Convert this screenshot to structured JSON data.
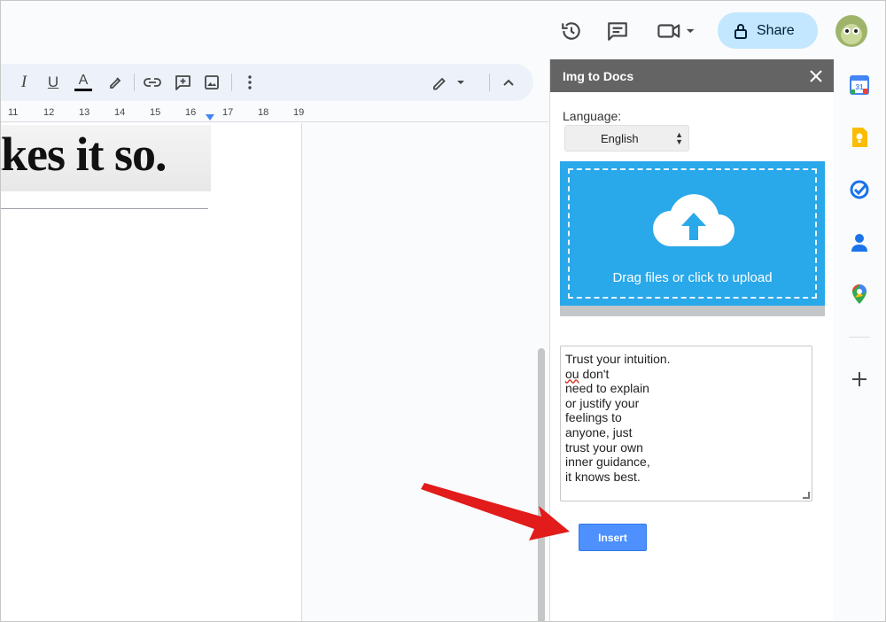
{
  "header": {
    "share_label": "Share",
    "icons": [
      "history-icon",
      "comment-icon",
      "video-call-icon",
      "lock-icon",
      "avatar"
    ]
  },
  "toolbar": {
    "icons": [
      "italic-icon",
      "underline-icon",
      "text-color-icon",
      "highlight-icon",
      "link-icon",
      "add-comment-icon",
      "insert-image-icon",
      "more-options-icon",
      "editing-mode-icon",
      "collapse-icon"
    ],
    "italic": "I",
    "underline": "U",
    "text_color": "A"
  },
  "ruler": {
    "numbers": [
      "11",
      "12",
      "13",
      "14",
      "15",
      "16",
      "17",
      "18",
      "19"
    ]
  },
  "document": {
    "image_text": "akes it so."
  },
  "addon": {
    "title": "Img to Docs",
    "language_label": "Language:",
    "language_value": "English",
    "upload_text": "Drag files or click to upload",
    "ocr_lines": [
      "Trust your intuition.",
      "ou don't",
      "need to explain",
      "or justify your",
      "feelings to",
      "anyone, just",
      "trust your own",
      "inner guidance,",
      "it knows best."
    ],
    "insert_label": "Insert"
  },
  "side_rail": {
    "icons": [
      "calendar-icon",
      "keep-icon",
      "tasks-icon",
      "contacts-icon",
      "maps-icon",
      "add-icon"
    ],
    "calendar_day": "31"
  },
  "colors": {
    "accent_blue": "#4d90fe",
    "upload_blue": "#29a8ea",
    "share_bg": "#c2e7ff",
    "addon_header": "#646464",
    "arrow_red": "#e21b1b"
  }
}
